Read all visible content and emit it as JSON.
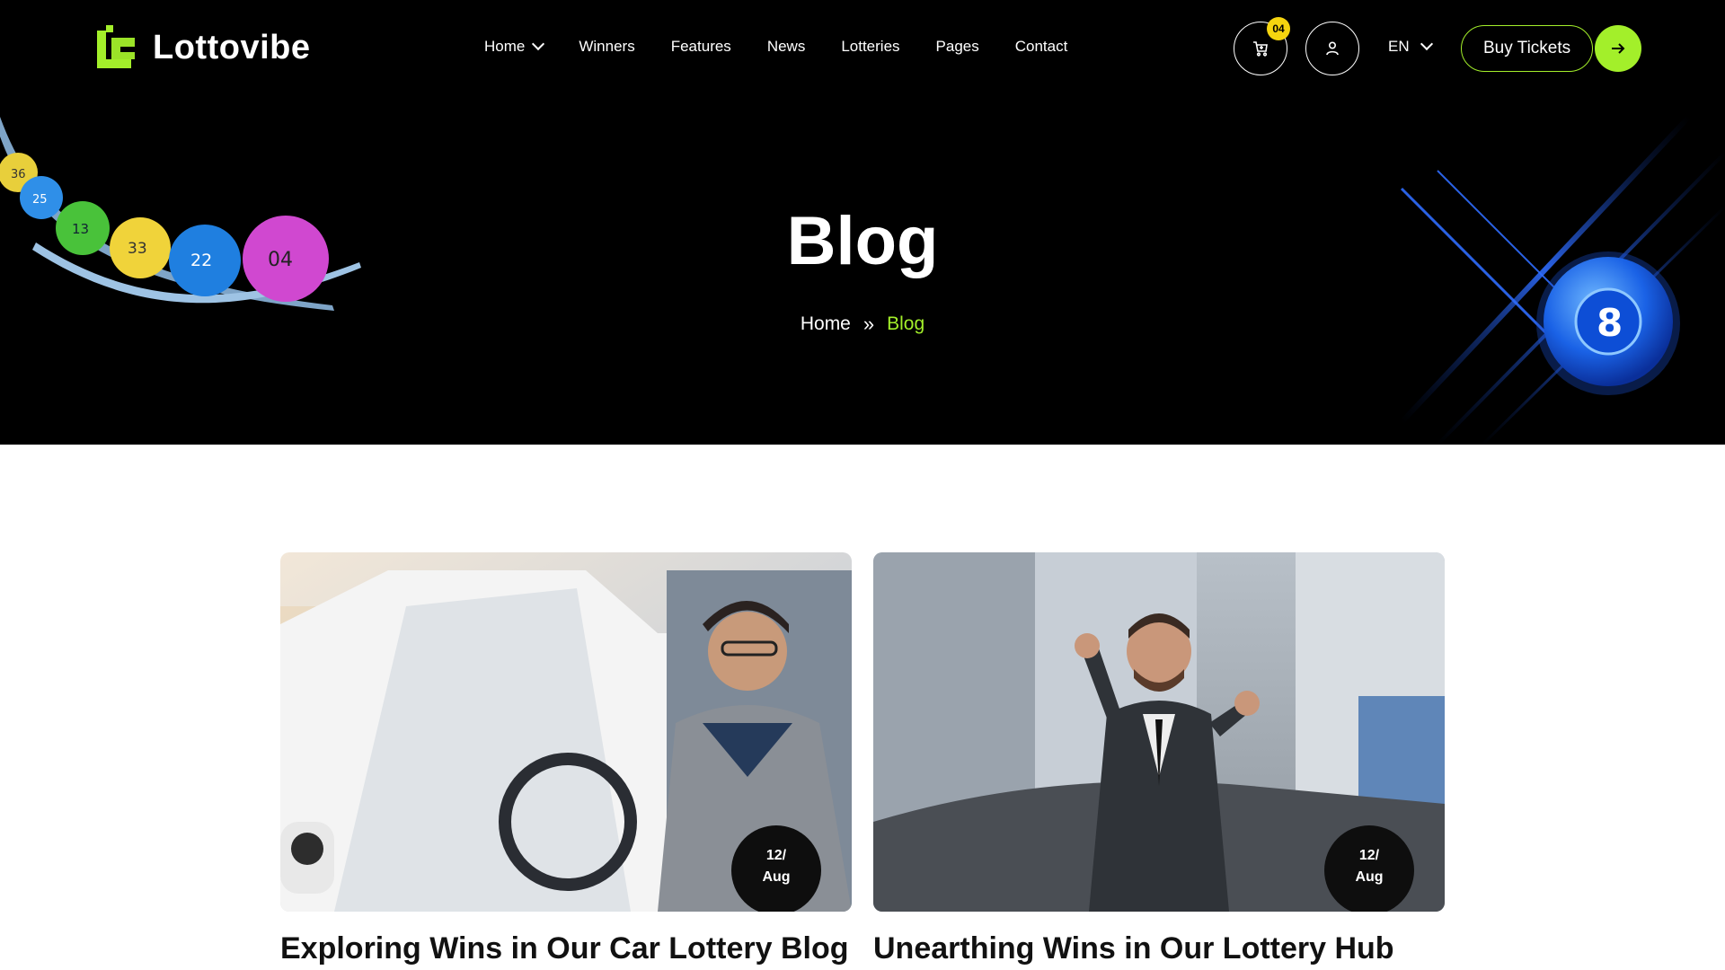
{
  "brand": {
    "name": "Lottovibe",
    "accent": "#a3ef2a",
    "badge_color": "#f5d40f"
  },
  "nav": {
    "items": [
      {
        "label": "Home",
        "has_dropdown": true
      },
      {
        "label": "Winners"
      },
      {
        "label": "Features"
      },
      {
        "label": "News"
      },
      {
        "label": "Lotteries"
      },
      {
        "label": "Pages"
      },
      {
        "label": "Contact"
      }
    ],
    "cart_count": "04",
    "language": "EN",
    "buy_label": "Buy Tickets"
  },
  "hero": {
    "title": "Blog",
    "breadcrumb": {
      "home": "Home",
      "separator": "»",
      "current": "Blog"
    },
    "balls": [
      "36",
      "25",
      "13",
      "33",
      "22",
      "04"
    ],
    "orb_number": "8"
  },
  "posts": [
    {
      "date_day": "12/",
      "date_month": "Aug",
      "title": "Exploring Wins in Our Car Lottery Blog"
    },
    {
      "date_day": "12/",
      "date_month": "Aug",
      "title": "Unearthing Wins in Our Lottery Hub"
    }
  ]
}
